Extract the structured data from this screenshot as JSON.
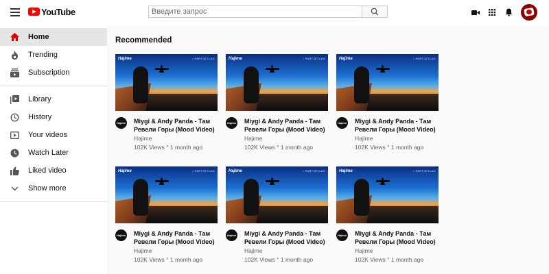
{
  "header": {
    "logo_text": "YouTube",
    "search": {
      "placeholder": "Введите запрос",
      "value": ""
    },
    "icons": [
      "menu-icon",
      "search-icon",
      "video-camera-icon",
      "apps-grid-icon",
      "bell-icon",
      "user-avatar"
    ]
  },
  "sidebar": {
    "items": [
      {
        "label": "Home",
        "icon": "home-icon",
        "active": true
      },
      {
        "label": "Trending",
        "icon": "flame-icon",
        "active": false
      },
      {
        "label": "Subscription",
        "icon": "subscriptions-icon",
        "active": false
      },
      {
        "label": "Library",
        "icon": "library-icon",
        "active": false
      },
      {
        "label": "History",
        "icon": "history-icon",
        "active": false
      },
      {
        "label": "Your videos",
        "icon": "play-icon",
        "active": false
      },
      {
        "label": "Watch Later",
        "icon": "clock-icon",
        "active": false
      },
      {
        "label": "Liked video",
        "icon": "thumbs-up-icon",
        "active": false
      },
      {
        "label": "Show more",
        "icon": "chevron-down-icon",
        "active": false
      }
    ]
  },
  "main": {
    "section_title": "Recommended",
    "videos": [
      {
        "title": "Miygi & Andy Panda - Там Ревели Горы (Mood Video)",
        "channel": "Hajime",
        "meta": "102K Views ° 1 month ago",
        "thumb_logo": "Hajime",
        "thumb_tag": "• PARTJETLAG"
      },
      {
        "title": "Miygi & Andy Panda - Там Ревели Горы (Mood Video)",
        "channel": "Hajime",
        "meta": "102K Views ° 1 month ago",
        "thumb_logo": "Hajime",
        "thumb_tag": "• PARTJETLAG"
      },
      {
        "title": "Miygi & Andy Panda - Там Ревели Горы (Mood Video)",
        "channel": "Hajime",
        "meta": "102K Views ° 1 month ago",
        "thumb_logo": "Hajime",
        "thumb_tag": "• PARTJETLAG"
      },
      {
        "title": "Miygi & Andy Panda - Там Ревели Горы (Mood Video)",
        "channel": "Hajime",
        "meta": "102K Views ° 1 month ago",
        "thumb_logo": "Hajime",
        "thumb_tag": "• PARTJETLAG"
      },
      {
        "title": "Miygi & Andy Panda - Там Ревели Горы (Mood Video)",
        "channel": "Hajime",
        "meta": "102K Views ° 1 month ago",
        "thumb_logo": "Hajime",
        "thumb_tag": "• PARTJETLAG"
      },
      {
        "title": "Miygi & Andy Panda - Там Ревели Горы (Mood Video)",
        "channel": "Hajime",
        "meta": "102K Views ° 1 month ago",
        "thumb_logo": "Hajime",
        "thumb_tag": "• PARTJETLAG"
      }
    ]
  },
  "colors": {
    "brand_red": "#ff0000",
    "active_bg": "#e5e5e5",
    "meta_text": "#606060",
    "page_bg": "#f9f9f9"
  }
}
